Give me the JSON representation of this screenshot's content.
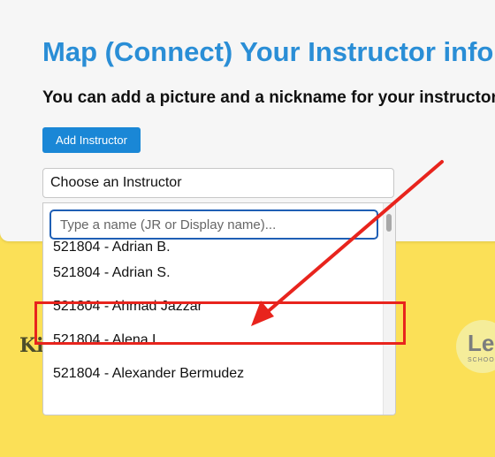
{
  "header": {
    "title": "Map (Connect) Your Instructor info",
    "subtitle": "You can add a picture and a nickname for your instructor"
  },
  "actions": {
    "add_instructor": "Add Instructor"
  },
  "instructor_select": {
    "selected": "Choose an Instructor",
    "search_placeholder": "Type a name (JR or Display name)...",
    "options": [
      "521804 - Adrian B.",
      "521804 - Adrian S.",
      "521804 - Ahmad Jazzar",
      "521804 - Alena L.",
      "521804 - Alexander Bermudez"
    ]
  },
  "annotation": {
    "highlighted_option": "521804 - Ahmad Jazzar",
    "color": "#e8241d"
  },
  "background_logos": {
    "left": "Ki",
    "right": "Le",
    "right_small": "SCHOO"
  },
  "colors": {
    "title": "#2a8ed6",
    "button": "#1a87d6",
    "page_bg": "#fbe057"
  }
}
